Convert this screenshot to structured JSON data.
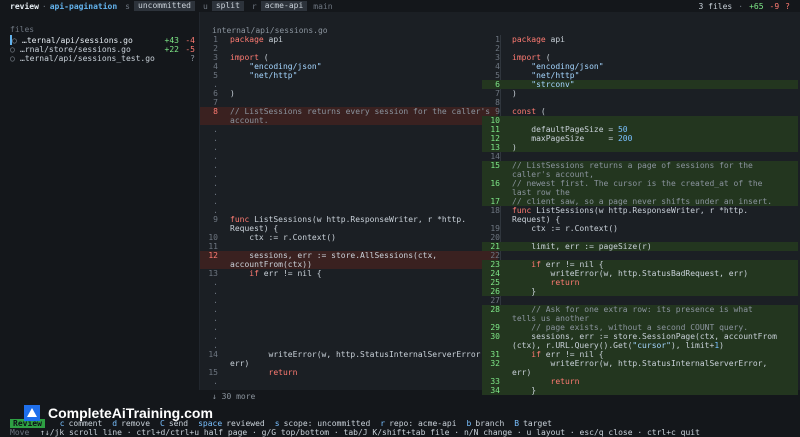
{
  "topbar": {
    "mode": "review",
    "sep": "·",
    "branch": "api-pagination",
    "s_key": "s",
    "scope": "uncommitted",
    "u_key": "u",
    "layout": "split",
    "r_key": "r",
    "repo": "acme-api",
    "base": "main",
    "files_count": "3 files",
    "sep2": "·",
    "adds": "+65",
    "dels": "-9",
    "unknown": "?"
  },
  "sidebar": {
    "heading": "files",
    "files": [
      {
        "bullet": "○",
        "name": "…ternal/api/sessions.go",
        "adds": "+43",
        "dels": "-4"
      },
      {
        "bullet": "○",
        "name": "…rnal/store/sessions.go",
        "adds": "+22",
        "dels": "-5"
      },
      {
        "bullet": "○",
        "name": "…ternal/api/sessions_test.go",
        "status": "?"
      }
    ]
  },
  "diff": {
    "path": "internal/api/sessions.go",
    "more": "↓ 30 more",
    "left": [
      {
        "ln": "1",
        "text": "package api"
      },
      {
        "ln": "2",
        "text": ""
      },
      {
        "ln": "3",
        "text": "import ("
      },
      {
        "ln": "4",
        "text": "    \"encoding/json\""
      },
      {
        "ln": "5",
        "text": "    \"net/http\""
      },
      {
        "ln": ".",
        "text": ""
      },
      {
        "ln": "6",
        "text": ")"
      },
      {
        "ln": "7",
        "text": ""
      },
      {
        "ln": "8",
        "text": "// ListSessions returns every session for the caller's"
      },
      {
        "ln": "",
        "text": "account."
      },
      {
        "ln": ".",
        "text": ""
      },
      {
        "ln": ".",
        "text": ""
      },
      {
        "ln": ".",
        "text": ""
      },
      {
        "ln": ".",
        "text": ""
      },
      {
        "ln": ".",
        "text": ""
      },
      {
        "ln": ".",
        "text": ""
      },
      {
        "ln": ".",
        "text": ""
      },
      {
        "ln": ".",
        "text": ""
      },
      {
        "ln": ".",
        "text": ""
      },
      {
        "ln": ".",
        "text": ""
      },
      {
        "ln": "9",
        "text": "func ListSessions(w http.ResponseWriter, r *http."
      },
      {
        "ln": "",
        "text": "Request) {"
      },
      {
        "ln": "10",
        "text": "    ctx := r.Context()"
      },
      {
        "ln": "11",
        "text": ""
      },
      {
        "ln": "12",
        "text": "    sessions, err := store.AllSessions(ctx,"
      },
      {
        "ln": "",
        "text": "accountFrom(ctx))"
      },
      {
        "ln": "13",
        "text": "    if err != nil {"
      },
      {
        "ln": ".",
        "text": ""
      },
      {
        "ln": ".",
        "text": ""
      },
      {
        "ln": ".",
        "text": ""
      },
      {
        "ln": ".",
        "text": ""
      },
      {
        "ln": ".",
        "text": ""
      },
      {
        "ln": ".",
        "text": ""
      },
      {
        "ln": ".",
        "text": ""
      },
      {
        "ln": ".",
        "text": ""
      },
      {
        "ln": "14",
        "text": "        writeError(w, http.StatusInternalServerError,"
      },
      {
        "ln": "",
        "text": "err)"
      },
      {
        "ln": "15",
        "text": "        return"
      },
      {
        "ln": ".",
        "text": ""
      }
    ],
    "right": [
      {
        "ln": "1",
        "text": "package api"
      },
      {
        "ln": "2",
        "text": ""
      },
      {
        "ln": "3",
        "text": "import ("
      },
      {
        "ln": "4",
        "text": "    \"encoding/json\""
      },
      {
        "ln": "5",
        "text": "    \"net/http\""
      },
      {
        "ln": "6",
        "text": "    \"strconv\""
      },
      {
        "ln": "7",
        "text": ")"
      },
      {
        "ln": "8",
        "text": ""
      },
      {
        "ln": "9",
        "text": "const ("
      },
      {
        "ln": "10",
        "text": ""
      },
      {
        "ln": "11",
        "text": "    defaultPageSize = 50"
      },
      {
        "ln": "12",
        "text": "    maxPageSize     = 200"
      },
      {
        "ln": "13",
        "text": ")"
      },
      {
        "ln": "14",
        "text": ""
      },
      {
        "ln": "15",
        "text": "// ListSessions returns a page of sessions for the"
      },
      {
        "ln": "",
        "text": "caller's account,"
      },
      {
        "ln": "16",
        "text": "// newest first. The cursor is the created_at of the"
      },
      {
        "ln": "",
        "text": "last row the"
      },
      {
        "ln": "17",
        "text": "// client saw, so a page never shifts under an insert."
      },
      {
        "ln": "18",
        "text": "func ListSessions(w http.ResponseWriter, r *http."
      },
      {
        "ln": "",
        "text": "Request) {"
      },
      {
        "ln": "19",
        "text": "    ctx := r.Context()"
      },
      {
        "ln": "20",
        "text": ""
      },
      {
        "ln": "21",
        "text": "    limit, err := pageSize(r)"
      },
      {
        "ln": "22",
        "text": ""
      },
      {
        "ln": "23",
        "text": "    if err != nil {"
      },
      {
        "ln": "24",
        "text": "        writeError(w, http.StatusBadRequest, err)"
      },
      {
        "ln": "25",
        "text": "        return"
      },
      {
        "ln": "26",
        "text": "    }"
      },
      {
        "ln": "27",
        "text": ""
      },
      {
        "ln": "28",
        "text": "    // Ask for one extra row: its presence is what"
      },
      {
        "ln": "",
        "text": "tells us another"
      },
      {
        "ln": "29",
        "text": "    // page exists, without a second COUNT query."
      },
      {
        "ln": "30",
        "text": "    sessions, err := store.SessionPage(ctx, accountFrom"
      },
      {
        "ln": "",
        "text": "(ctx), r.URL.Query().Get(\"cursor\"), limit+1)"
      },
      {
        "ln": "31",
        "text": "    if err != nil {"
      },
      {
        "ln": "32",
        "text": "        writeError(w, http.StatusInternalServerError,"
      },
      {
        "ln": "",
        "text": "err)"
      },
      {
        "ln": "33",
        "text": "        return"
      },
      {
        "ln": "34",
        "text": "    }"
      }
    ]
  },
  "footer": {
    "badge": "Review",
    "row1": [
      {
        "k": "c",
        "v": "comment"
      },
      {
        "k": "d",
        "v": "remove"
      },
      {
        "k": "C",
        "v": "send"
      },
      {
        "k": "space",
        "v": "reviewed"
      },
      {
        "k": "s",
        "v": "scope: uncommitted"
      },
      {
        "k": "r",
        "v": "repo: acme-api"
      },
      {
        "k": "b",
        "v": "branch"
      },
      {
        "k": "B",
        "v": "target"
      }
    ],
    "move_label": "Move",
    "row2": "↑↓/jk scroll line · ctrl+d/ctrl+u half page · g/G top/bottom · tab/J K/shift+tab file · n/N change · u layout · esc/q close · ctrl+c quit"
  },
  "watermark": {
    "text": "CompleteAiTraining.com"
  }
}
